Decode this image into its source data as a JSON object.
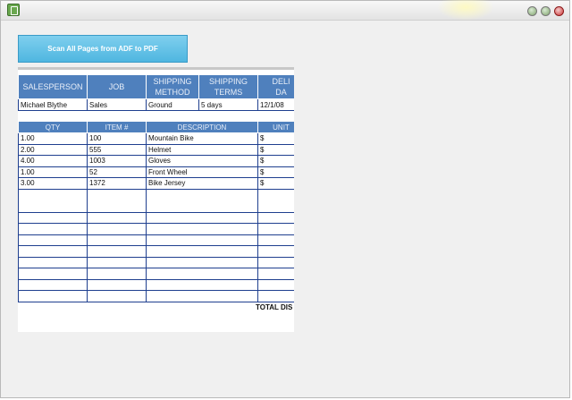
{
  "window": {
    "title": ""
  },
  "toolbar": {
    "scan_label": "Scan All Pages from ADF to PDF"
  },
  "invoice": {
    "info_headers": [
      "SALESPERSON",
      "JOB",
      "SHIPPING\nMETHOD",
      "SHIPPING\nTERMS",
      "DELI\nDA"
    ],
    "info_row": [
      "Michael Blythe",
      "Sales",
      "Ground",
      "5 days",
      "12/1/08"
    ],
    "item_headers": [
      "QTY",
      "ITEM #",
      "DESCRIPTION",
      "UNIT"
    ],
    "items": [
      {
        "qty": "1.00",
        "item": "100",
        "desc": "Mountain Bike",
        "unit": "$"
      },
      {
        "qty": "2.00",
        "item": "555",
        "desc": "Helmet",
        "unit": "$"
      },
      {
        "qty": "4.00",
        "item": "1003",
        "desc": "Gloves",
        "unit": "$"
      },
      {
        "qty": "1.00",
        "item": "52",
        "desc": "Front Wheel",
        "unit": "$"
      },
      {
        "qty": "3.00",
        "item": "1372",
        "desc": "Bike Jersey",
        "unit": "$"
      }
    ],
    "total_label": "TOTAL DIS"
  },
  "colors": {
    "header_blue": "#4f80bd",
    "rule_blue": "#1f3f8f",
    "button_blue": "#5bbde4"
  },
  "icons": [
    "app-icon",
    "minimize-icon",
    "maximize-icon",
    "close-icon"
  ]
}
